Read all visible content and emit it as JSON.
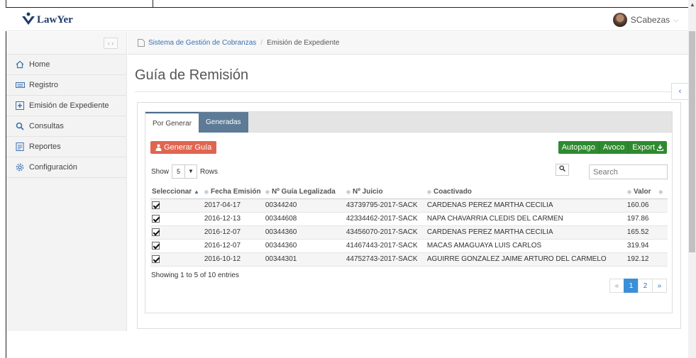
{
  "app": {
    "logo_text": "Law",
    "logo_text_b": "Yer"
  },
  "user": {
    "name": "SCabezas"
  },
  "sidebar": {
    "toggle": "‹ ›",
    "items": [
      {
        "label": "Home",
        "icon": "home-icon"
      },
      {
        "label": "Registro",
        "icon": "keyboard-icon"
      },
      {
        "label": "Emisión de Expediente",
        "icon": "plus-square-icon"
      },
      {
        "label": "Consultas",
        "icon": "search-icon"
      },
      {
        "label": "Reportes",
        "icon": "report-icon"
      },
      {
        "label": "Configuración",
        "icon": "gear-icon"
      }
    ]
  },
  "breadcrumb": {
    "root": "Sistema de Gestión de Cobranzas",
    "separator": "/",
    "current": "Emisión de Expediente"
  },
  "page": {
    "title": "Guía de Remisión"
  },
  "tabs": [
    {
      "label": "Por Generar",
      "active": true
    },
    {
      "label": "Generadas",
      "active": false
    }
  ],
  "actions": {
    "generar": "Generar Guía",
    "autopago": "Autopago",
    "avoco": "Avoco",
    "export": "Export"
  },
  "table_controls": {
    "show_label": "Show",
    "show_value": "5",
    "rows_label": "Rows",
    "search_placeholder": "Search"
  },
  "table": {
    "columns": [
      "Seleccionar",
      "Fecha Emisión",
      "Nº Guía Legalizada",
      "Nº Juicio",
      "Coactivado",
      "Valor"
    ],
    "rows": [
      {
        "fecha": "2017-04-17",
        "guia": "00344240",
        "juicio": "43739795-2017-SACK",
        "coactivado": "CARDENAS PEREZ MARTHA CECILIA",
        "valor": "160.06"
      },
      {
        "fecha": "2016-12-13",
        "guia": "00344608",
        "juicio": "42334462-2017-SACK",
        "coactivado": "NAPA CHAVARRIA CLEDIS DEL CARMEN",
        "valor": "197.86"
      },
      {
        "fecha": "2016-12-07",
        "guia": "00344360",
        "juicio": "43456070-2017-SACK",
        "coactivado": "CARDENAS PEREZ MARTHA CECILIA",
        "valor": "165.52"
      },
      {
        "fecha": "2016-12-07",
        "guia": "00344360",
        "juicio": "41467443-2017-SACK",
        "coactivado": "MACAS AMAGUAYA LUIS CARLOS",
        "valor": "319.94"
      },
      {
        "fecha": "2016-10-12",
        "guia": "00344301",
        "juicio": "44752743-2017-SACK",
        "coactivado": "AGUIRRE GONZALEZ JAIME ARTURO DEL CARMELO",
        "valor": "192.12"
      }
    ]
  },
  "info": "Showing 1 to 5 of 10 entries",
  "pagination": {
    "prev": "«",
    "pages": [
      "1",
      "2"
    ],
    "next": "»"
  },
  "colors": {
    "accent": "#3a6fb0",
    "generar": "#e0654f",
    "green": "#2f8a2f",
    "tab_inactive": "#5d7a96"
  }
}
